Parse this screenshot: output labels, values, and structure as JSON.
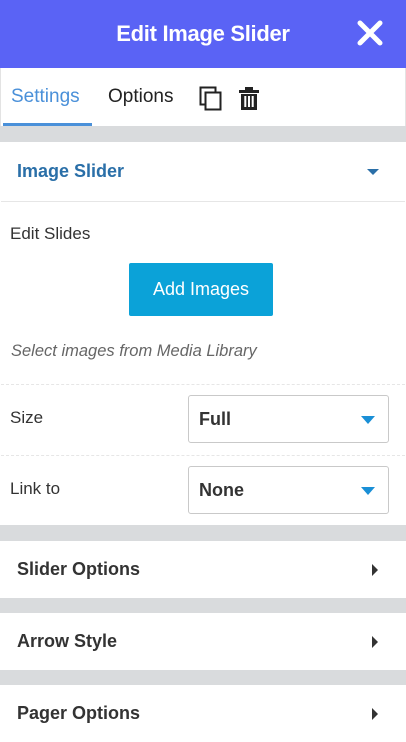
{
  "header": {
    "title": "Edit Image Slider",
    "close_icon": "close-icon"
  },
  "tabs": {
    "settings": "Settings",
    "options": "Options"
  },
  "toolbar": {
    "copy_icon": "copy-icon",
    "delete_icon": "trash-icon"
  },
  "image_slider": {
    "title": "Image Slider",
    "edit_slides_label": "Edit Slides",
    "add_button": "Add Images",
    "hint": "Select images from Media Library",
    "size": {
      "label": "Size",
      "value": "Full"
    },
    "link_to": {
      "label": "Link to",
      "value": "None"
    }
  },
  "sections": {
    "slider_options": "Slider Options",
    "arrow_style": "Arrow Style",
    "pager_options": "Pager Options"
  },
  "colors": {
    "header": "#5a63f5",
    "accent": "#4a90d9",
    "button": "#0ba2d8",
    "dropdown_arrow": "#1a8fd6"
  }
}
